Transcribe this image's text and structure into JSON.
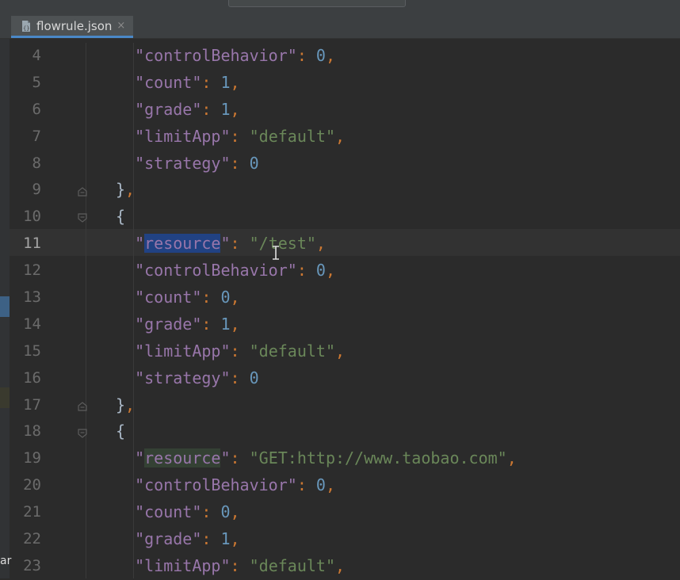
{
  "tab": {
    "filename": "flowrule.json",
    "close": "×",
    "icon": "json-file-icon"
  },
  "colors": {
    "background": "#2b2b2b",
    "key": "#9876aa",
    "string": "#6a8759",
    "number": "#6897bb",
    "punct": "#cc7832",
    "selection": "#214283"
  },
  "left_cut_text": "ar",
  "lines": [
    {
      "no": "4",
      "indent": "  ",
      "key": "controlBehavior",
      "value": "0",
      "vtype": "n",
      "comma": ","
    },
    {
      "no": "5",
      "indent": "  ",
      "key": "count",
      "value": "1",
      "vtype": "n",
      "comma": ","
    },
    {
      "no": "6",
      "indent": "  ",
      "key": "grade",
      "value": "1",
      "vtype": "n",
      "comma": ","
    },
    {
      "no": "7",
      "indent": "  ",
      "key": "limitApp",
      "value": "\"default\"",
      "vtype": "s",
      "comma": ","
    },
    {
      "no": "8",
      "indent": "  ",
      "key": "strategy",
      "value": "0",
      "vtype": "n",
      "comma": ""
    },
    {
      "no": "9",
      "brace": "},",
      "fold": true
    },
    {
      "no": "10",
      "brace": "{",
      "fold": true
    },
    {
      "no": "11",
      "indent": "  ",
      "key": "resource",
      "value": "\"/test\"",
      "vtype": "s",
      "comma": ",",
      "selected": true,
      "current": true
    },
    {
      "no": "12",
      "indent": "  ",
      "key": "controlBehavior",
      "value": "0",
      "vtype": "n",
      "comma": ","
    },
    {
      "no": "13",
      "indent": "  ",
      "key": "count",
      "value": "0",
      "vtype": "n",
      "comma": ","
    },
    {
      "no": "14",
      "indent": "  ",
      "key": "grade",
      "value": "1",
      "vtype": "n",
      "comma": ","
    },
    {
      "no": "15",
      "indent": "  ",
      "key": "limitApp",
      "value": "\"default\"",
      "vtype": "s",
      "comma": ","
    },
    {
      "no": "16",
      "indent": "  ",
      "key": "strategy",
      "value": "0",
      "vtype": "n",
      "comma": ""
    },
    {
      "no": "17",
      "brace": "},",
      "fold": true
    },
    {
      "no": "18",
      "brace": "{",
      "fold": true
    },
    {
      "no": "19",
      "indent": "  ",
      "key": "resource",
      "value": "\"GET:http://www.taobao.com\"",
      "vtype": "s",
      "comma": ",",
      "highlight": true
    },
    {
      "no": "20",
      "indent": "  ",
      "key": "controlBehavior",
      "value": "0",
      "vtype": "n",
      "comma": ","
    },
    {
      "no": "21",
      "indent": "  ",
      "key": "count",
      "value": "0",
      "vtype": "n",
      "comma": ","
    },
    {
      "no": "22",
      "indent": "  ",
      "key": "grade",
      "value": "1",
      "vtype": "n",
      "comma": ","
    },
    {
      "no": "23",
      "indent": "  ",
      "key": "limitApp",
      "value": "\"default\"",
      "vtype": "s",
      "comma": ","
    }
  ]
}
